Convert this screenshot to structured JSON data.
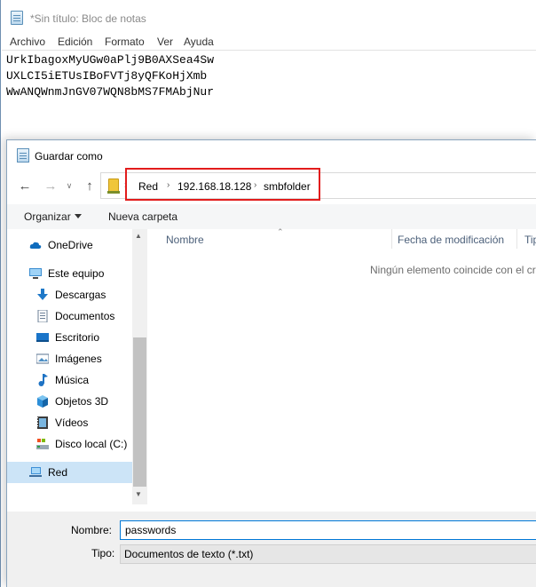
{
  "notepad": {
    "title": "*Sin título: Bloc de notas",
    "menu": [
      "Archivo",
      "Edición",
      "Formato",
      "Ver",
      "Ayuda"
    ],
    "lines": [
      "UrkIbagoxMyUGw0aPlj9B0AXSea4Sw",
      "UXLCI5iETUsIBoFVTj8yQFKoHjXmb",
      "WwANQWnmJnGV07WQN8bMS7FMAbjNur"
    ]
  },
  "dialog": {
    "title": "Guardar como",
    "address": {
      "crumbs": [
        "Red",
        "192.168.18.128",
        "smbfolder"
      ],
      "highlight_color": "#e21c1c"
    },
    "toolbar": {
      "organize": "Organizar",
      "new_folder": "Nueva carpeta"
    },
    "sidebar": {
      "items": [
        {
          "label": "OneDrive",
          "icon": "cloud-icon"
        },
        {
          "label": "Este equipo",
          "icon": "computer-icon"
        },
        {
          "label": "Descargas",
          "icon": "download-icon"
        },
        {
          "label": "Documentos",
          "icon": "documents-icon"
        },
        {
          "label": "Escritorio",
          "icon": "desktop-icon"
        },
        {
          "label": "Imágenes",
          "icon": "pictures-icon"
        },
        {
          "label": "Música",
          "icon": "music-icon"
        },
        {
          "label": "Objetos 3D",
          "icon": "cube-icon"
        },
        {
          "label": "Vídeos",
          "icon": "video-icon"
        },
        {
          "label": "Disco local (C:)",
          "icon": "drive-icon"
        },
        {
          "label": "Red",
          "icon": "network-icon",
          "selected": true
        }
      ]
    },
    "columns": [
      "Nombre",
      "Fecha de modificación",
      "Tip"
    ],
    "empty_message": "Ningún elemento coincide con el cr",
    "footer": {
      "name_label": "Nombre:",
      "name_value": "passwords",
      "type_label": "Tipo:",
      "type_value": "Documentos de texto (*.txt)"
    },
    "colors": {
      "selection": "#cce4f7",
      "accent": "#0078d7"
    }
  }
}
